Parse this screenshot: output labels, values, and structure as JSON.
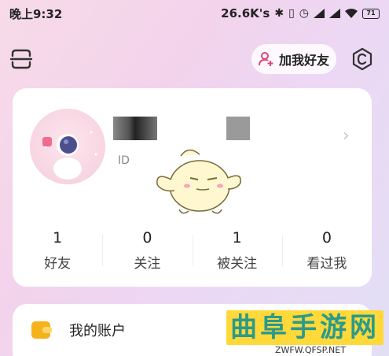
{
  "status_bar": {
    "time": "晚上9:32",
    "network_speed": "26.6K's",
    "battery": "71"
  },
  "header": {
    "add_friend_label": "加我好友"
  },
  "profile": {
    "id_label": "ID"
  },
  "stats": [
    {
      "count": "1",
      "label": "好友"
    },
    {
      "count": "0",
      "label": "关注"
    },
    {
      "count": "1",
      "label": "被关注"
    },
    {
      "count": "0",
      "label": "看过我"
    }
  ],
  "account": {
    "label": "我的账户"
  },
  "watermark": {
    "title": "曲阜手游网",
    "url": "ZWFW.QFSP.NET"
  },
  "colors": {
    "accent_pink": "#e3457a",
    "wallet_yellow": "#f5b21a",
    "watermark_bg": "#ffd83a",
    "watermark_text": "#2a9a8a"
  }
}
